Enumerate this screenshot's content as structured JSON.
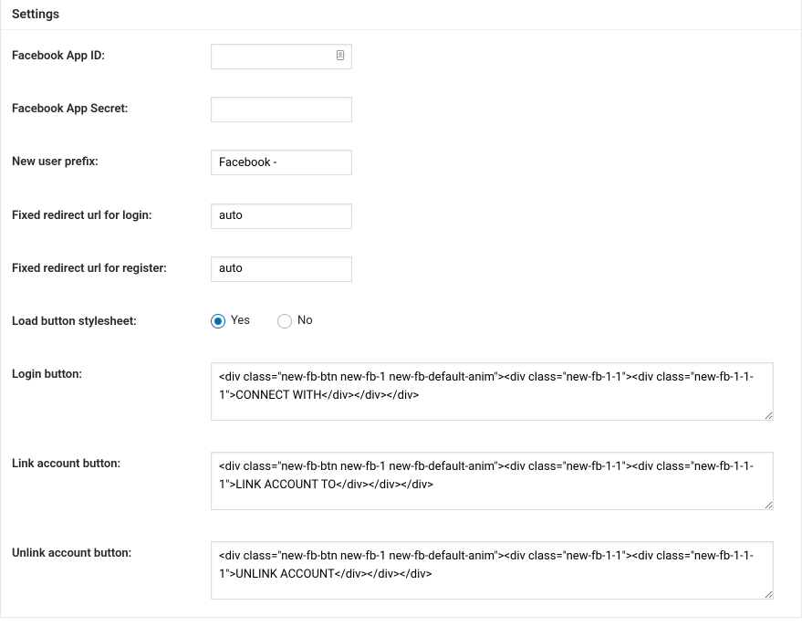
{
  "panel": {
    "title": "Settings"
  },
  "fields": {
    "appId": {
      "label": "Facebook App ID:",
      "value": ""
    },
    "appSecret": {
      "label": "Facebook App Secret:",
      "value": ""
    },
    "userPrefix": {
      "label": "New user prefix:",
      "value": "Facebook -"
    },
    "redirectLogin": {
      "label": "Fixed redirect url for login:",
      "value": "auto"
    },
    "redirectRegister": {
      "label": "Fixed redirect url for register:",
      "value": "auto"
    },
    "loadStylesheet": {
      "label": "Load button stylesheet:",
      "yes": "Yes",
      "no": "No"
    },
    "loginButton": {
      "label": "Login button:",
      "value": "<div class=\"new-fb-btn new-fb-1 new-fb-default-anim\"><div class=\"new-fb-1-1\"><div class=\"new-fb-1-1-1\">CONNECT WITH</div></div></div>"
    },
    "linkButton": {
      "label": "Link account button:",
      "value": "<div class=\"new-fb-btn new-fb-1 new-fb-default-anim\"><div class=\"new-fb-1-1\"><div class=\"new-fb-1-1-1\">LINK ACCOUNT TO</div></div></div>"
    },
    "unlinkButton": {
      "label": "Unlink account button:",
      "value": "<div class=\"new-fb-btn new-fb-1 new-fb-default-anim\"><div class=\"new-fb-1-1\"><div class=\"new-fb-1-1-1\">UNLINK ACCOUNT</div></div></div>"
    }
  }
}
